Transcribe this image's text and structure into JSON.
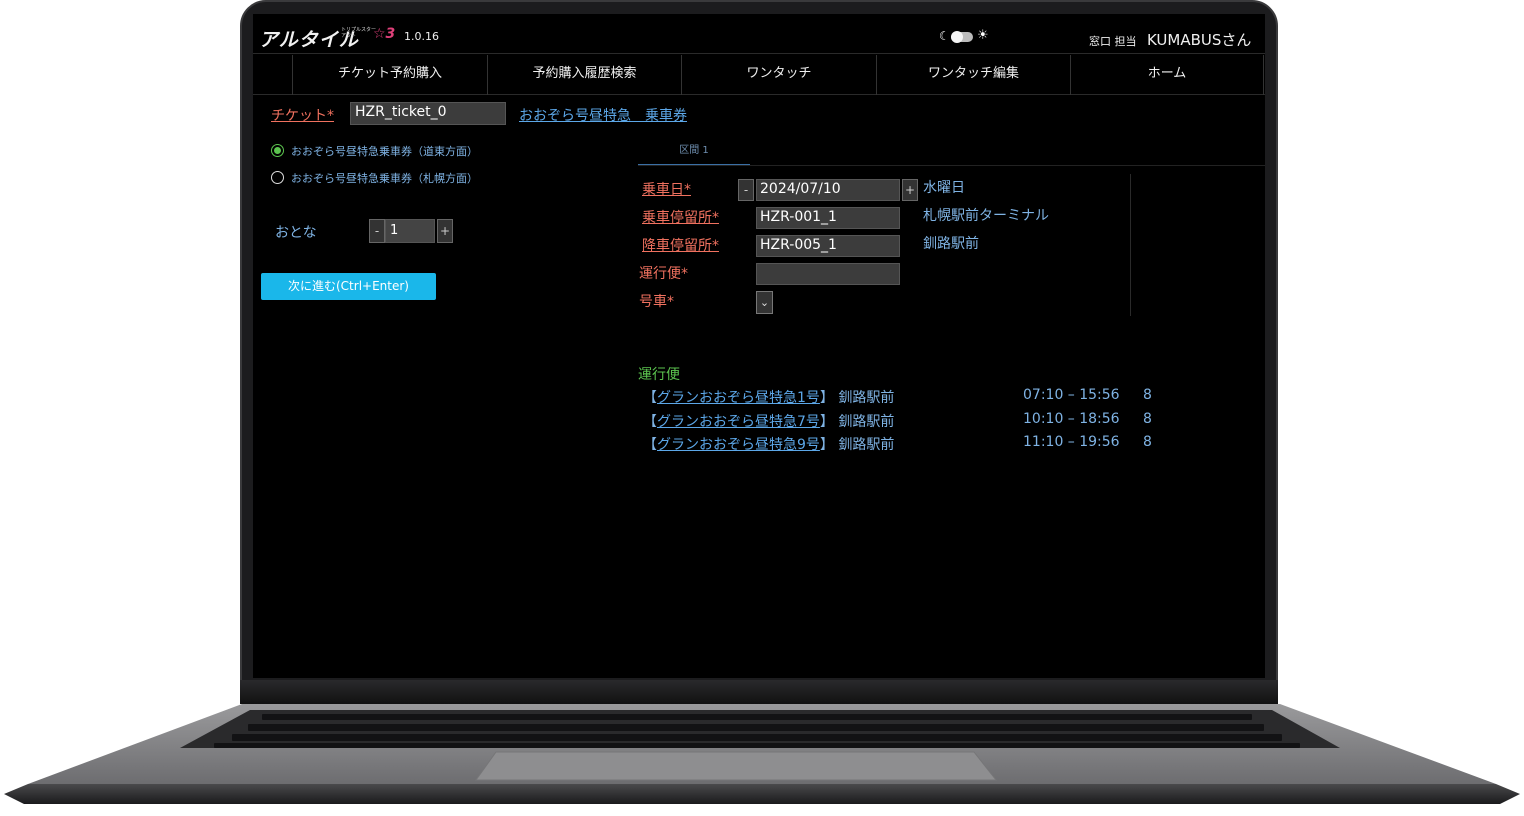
{
  "header": {
    "logo": "アルタイル",
    "logo_sub": "トリプルスター アウト",
    "logo_mark": "☆3",
    "version": "1.0.16",
    "counter_label": "窓口 担当",
    "user": "KUMABUSさん"
  },
  "nav": {
    "items": [
      {
        "label": "チケット予約購入"
      },
      {
        "label": "予約購入履歴検索"
      },
      {
        "label": "ワンタッチ"
      },
      {
        "label": "ワンタッチ編集"
      },
      {
        "label": "ホーム"
      }
    ]
  },
  "ticket": {
    "label": "チケット*",
    "value": "HZR_ticket_0",
    "name": "おおぞら号昼特急　乗車券"
  },
  "direction": {
    "options": [
      {
        "label": "おおぞら号昼特急乗車券（道東方面）",
        "selected": true
      },
      {
        "label": "おおぞら号昼特急乗車券（札幌方面）",
        "selected": false
      }
    ]
  },
  "passenger": {
    "label": "おとな",
    "quantity": "1",
    "minus": "-",
    "plus": "+"
  },
  "next_button": "次に進む(Ctrl+Enter)",
  "section": {
    "tab": "区間 1",
    "date_label": "乗車日*",
    "date_value": "2024/07/10",
    "weekday": "水曜日",
    "minus": "-",
    "plus": "+",
    "board_label": "乗車停留所*",
    "board_value": "HZR-001_1",
    "board_name": "札幌駅前ターミナル",
    "alight_label": "降車停留所*",
    "alight_value": "HZR-005_1",
    "alight_name": "釧路駅前",
    "run_label": "運行便*",
    "run_value": "",
    "car_label": "号車*",
    "car_select_icon": "⌄"
  },
  "runs": {
    "title": "運行便",
    "items": [
      {
        "open": "【",
        "name": "グランおおぞら昼特急1号",
        "close": "】",
        "dest": "釧路駅前",
        "time": "07:10 – 15:56",
        "count": "8"
      },
      {
        "open": "【",
        "name": "グランおおぞら昼特急7号",
        "close": "】",
        "dest": "釧路駅前",
        "time": "10:10 – 18:56",
        "count": "8"
      },
      {
        "open": "【",
        "name": "グランおおぞら昼特急9号",
        "close": "】",
        "dest": "釧路駅前",
        "time": "11:10 – 19:56",
        "count": "8"
      }
    ]
  },
  "colors": {
    "accent": "#1ab7ea",
    "required_label": "#f0715f",
    "link": "#5ca7e8",
    "info": "#7fb3e4",
    "success": "#5cc44f",
    "background": "#000000"
  },
  "icons": {
    "theme_dark": "moon-icon",
    "theme_light": "sun-icon",
    "select": "chevron-down-icon"
  }
}
